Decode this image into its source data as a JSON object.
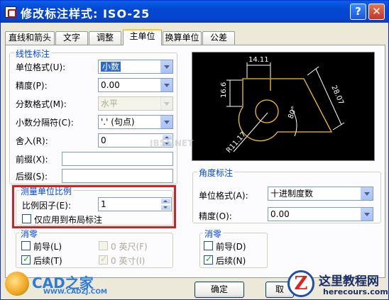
{
  "window": {
    "title": "修改标注样式: ISO-25",
    "help": "?",
    "close": "✕"
  },
  "tabs": [
    "直线和箭头",
    "文字",
    "调整",
    "主单位",
    "换算单位",
    "公差"
  ],
  "linear": {
    "group": "线性标注",
    "unit_format_label": "单位格式(U):",
    "unit_format_value": "小数",
    "precision_label": "精度(P):",
    "precision_value": "0.00",
    "fraction_label": "分数格式(M):",
    "fraction_value": "水平",
    "decimal_sep_label": "小数分隔符(C):",
    "decimal_sep_value": "'.' (句点)",
    "round_label": "舍入(R):",
    "round_value": "0",
    "prefix_label": "前缀(X):",
    "prefix_value": "",
    "suffix_label": "后缀(S):",
    "suffix_value": ""
  },
  "scale": {
    "group": "测量单位比例",
    "factor_label": "比例因子(E):",
    "factor_value": "1",
    "layout_only_label": "仅应用到布局标注"
  },
  "zero_linear": {
    "group": "消零",
    "leading": "前导(L)",
    "trailing": "后续(T)",
    "feet": "0 英尺(F)",
    "inches": "0 英寸(I)"
  },
  "angular": {
    "group": "角度标注",
    "unit_format_label": "单位格式(A):",
    "unit_format_value": "十进制度数",
    "precision_label": "精度(O):",
    "precision_value": "0.00"
  },
  "zero_angular": {
    "group": "消零",
    "leading": "前导(D)",
    "trailing": "后续(N)"
  },
  "preview": {
    "dim_top": "14.11",
    "dim_left": "16.6",
    "dim_slant": "28.07",
    "angle": "80°",
    "radius": "R11.17"
  },
  "buttons": {
    "ok": "确定",
    "cancel": "取"
  },
  "watermarks": {
    "cad_logo": "CAD之家",
    "cad_url": "WWW.CADZJ.COM",
    "site_cn": "这里教程网",
    "site_en": "herecours.com",
    "center": "JB51.NET"
  }
}
